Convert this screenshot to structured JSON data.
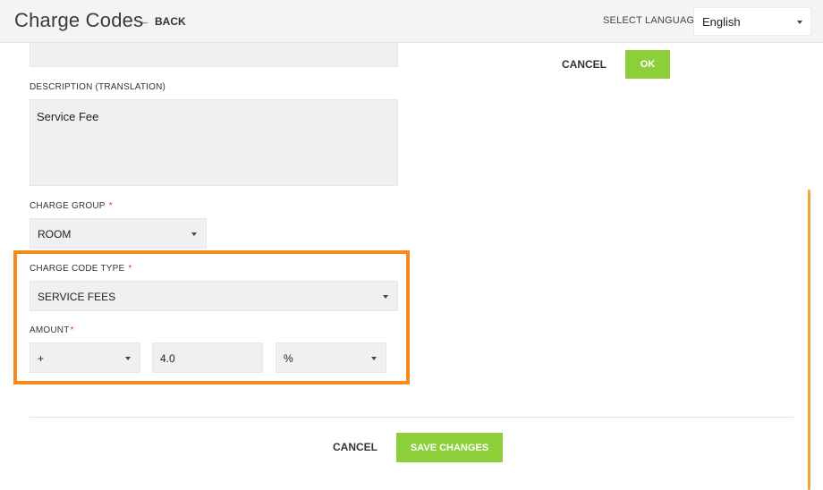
{
  "header": {
    "title": "Charge Codes",
    "back_label": "BACK",
    "back_icon": "arrow-left-icon",
    "language_label": "SELECT LANGUAGE",
    "language_value": "English"
  },
  "dialog": {
    "cancel_label": "CANCEL",
    "ok_label": "OK"
  },
  "form": {
    "description_translation": {
      "label": "DESCRIPTION (TRANSLATION)",
      "value": "Service Fee"
    },
    "charge_group": {
      "label": "CHARGE GROUP",
      "required_mark": "*",
      "value": "ROOM"
    },
    "charge_code_type": {
      "label": "CHARGE CODE TYPE",
      "required_mark": "*",
      "value": "SERVICE FEES"
    },
    "amount": {
      "label": "AMOUNT",
      "required_mark": "*",
      "sign": "+",
      "value": "4.0",
      "unit": "%"
    }
  },
  "footer": {
    "cancel_label": "CANCEL",
    "save_label": "SAVE CHANGES"
  },
  "colors": {
    "accent_green": "#8ccf3a",
    "highlight_orange": "#f78a1d",
    "required_red": "#e03232",
    "scrollbar": "#f3a535"
  }
}
